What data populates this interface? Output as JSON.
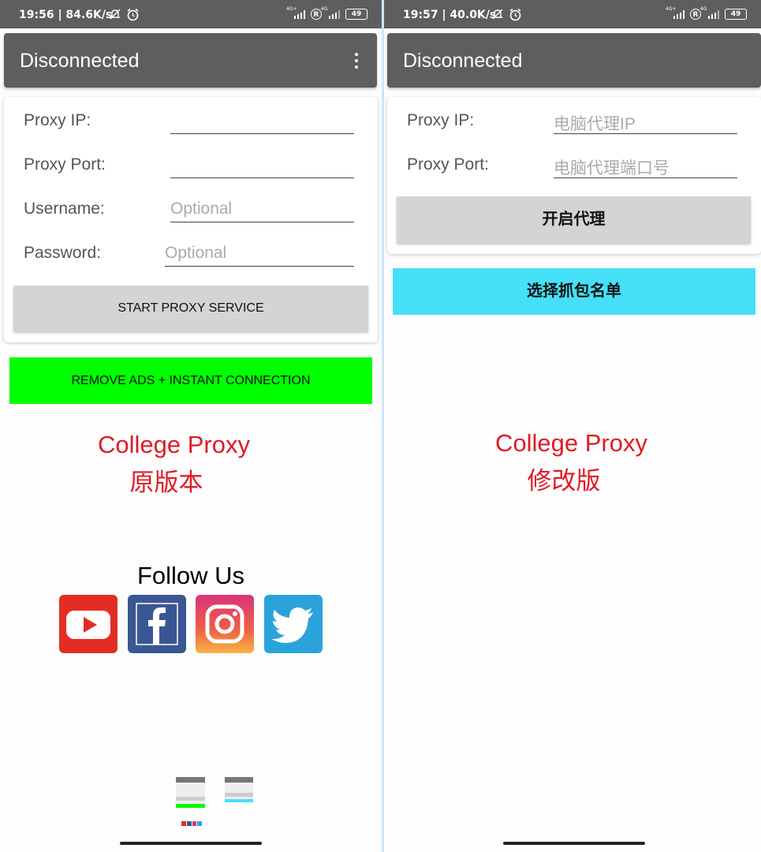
{
  "left": {
    "status": {
      "time": "19:56 | 84.6K/s",
      "net1": "4G+",
      "net2": "4G",
      "roaming": "R",
      "battery": "49"
    },
    "appbar": {
      "title": "Disconnected"
    },
    "form": {
      "ip_label": "Proxy IP:",
      "port_label": "Proxy Port:",
      "user_label": "Username:",
      "user_placeholder": "Optional",
      "pass_label": "Password:",
      "pass_placeholder": "Optional",
      "start_button": "START PROXY SERVICE"
    },
    "ads_button": "REMOVE ADS + INSTANT CONNECTION",
    "caption": {
      "line1": "College Proxy",
      "line2": "原版本"
    },
    "follow": {
      "title": "Follow Us",
      "icons": [
        "youtube-icon",
        "facebook-icon",
        "instagram-icon",
        "twitter-icon"
      ]
    }
  },
  "right": {
    "status": {
      "time": "19:57 | 40.0K/s",
      "net1": "4G+",
      "net2": "4G",
      "roaming": "R",
      "battery": "49"
    },
    "appbar": {
      "title": "Disconnected"
    },
    "form": {
      "ip_label": "Proxy IP:",
      "ip_placeholder": "电脑代理IP",
      "port_label": "Proxy Port:",
      "port_placeholder": "电脑代理端口号",
      "start_button": "开启代理"
    },
    "select_button": "选择抓包名单",
    "caption": {
      "line1": "College Proxy",
      "line2": "修改版"
    }
  },
  "colors": {
    "appbar": "#5e5e5e",
    "green": "#00ff00",
    "cyan": "#45e0f8",
    "red": "#e01b25"
  }
}
